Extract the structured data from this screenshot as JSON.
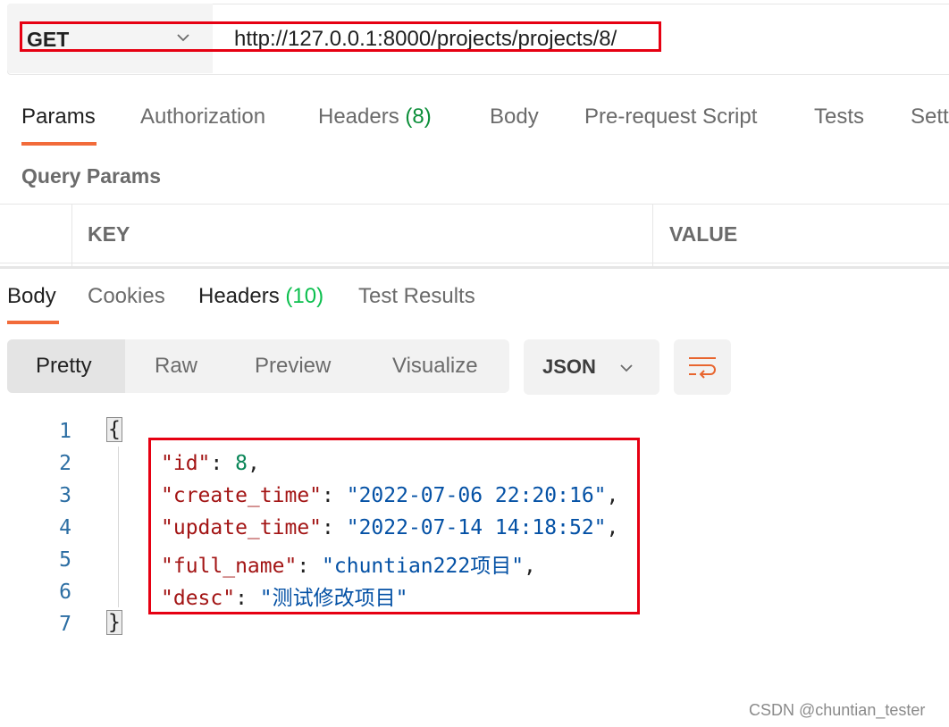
{
  "request": {
    "method": "GET",
    "url": "http://127.0.0.1:8000/projects/projects/8/"
  },
  "request_tabs": [
    {
      "label": "Params"
    },
    {
      "label": "Authorization"
    },
    {
      "label": "Headers",
      "count": "(8)"
    },
    {
      "label": "Body"
    },
    {
      "label": "Pre-request Script"
    },
    {
      "label": "Tests"
    },
    {
      "label": "Sett"
    }
  ],
  "query_params": {
    "title": "Query Params",
    "columns": [
      "KEY",
      "VALUE"
    ]
  },
  "response_tabs": [
    {
      "label": "Body"
    },
    {
      "label": "Cookies"
    },
    {
      "label": "Headers",
      "count": "(10)"
    },
    {
      "label": "Test Results"
    }
  ],
  "view_modes": [
    "Pretty",
    "Raw",
    "Preview",
    "Visualize"
  ],
  "format": "JSON",
  "code": {
    "line_numbers": [
      "1",
      "2",
      "3",
      "4",
      "5",
      "6",
      "7"
    ],
    "open_brace": "{",
    "close_brace": "}",
    "lines": [
      {
        "key": "\"id\"",
        "sep": ": ",
        "value": "8",
        "tail": ","
      },
      {
        "key": "\"create_time\"",
        "sep": ": ",
        "value": "\"2022-07-06 22:20:16\"",
        "tail": ","
      },
      {
        "key": "\"update_time\"",
        "sep": ": ",
        "value": "\"2022-07-14 14:18:52\"",
        "tail": ","
      },
      {
        "key": "\"full_name\"",
        "sep": ": ",
        "value": "\"chuntian222项目\"",
        "tail": ","
      },
      {
        "key": "\"desc\"",
        "sep": ": ",
        "value": "\"测试修改项目\"",
        "tail": ""
      }
    ]
  },
  "watermark": "CSDN @chuntian_tester",
  "colors": {
    "accent_underline": "#f26b3a",
    "highlight_box": "#e60012",
    "json_key": "#a31515",
    "json_string": "#0451a5",
    "json_number": "#098658"
  }
}
